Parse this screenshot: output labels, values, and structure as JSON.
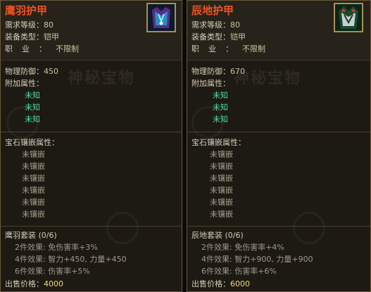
{
  "watermark": "神秘宝物",
  "labels": {
    "level": "需求等级：",
    "type": "装备类型：",
    "job": "职业：",
    "defense": "物理防御：",
    "extra": "附加属性：",
    "gem": "宝石镶嵌属性：",
    "price": "出售价格："
  },
  "items": [
    {
      "name": "鹰羽护甲",
      "level": "80",
      "type": "铠甲",
      "job": "不限制",
      "defense": "450",
      "extra_attrs": [
        "未知",
        "未知",
        "未知"
      ],
      "gem_slots": [
        "未镶嵌",
        "未镶嵌",
        "未镶嵌",
        "未镶嵌",
        "未镶嵌",
        "未镶嵌"
      ],
      "set_name": "鹰羽套装 (0/6)",
      "set_effects": [
        "2件效果: 免伤害率+3%",
        "4件效果: 智力+450, 力量+450",
        "6件效果: 伤害率+5%"
      ],
      "price": "4000"
    },
    {
      "name": "辰地护甲",
      "level": "80",
      "type": "铠甲",
      "job": "不限制",
      "defense": "670",
      "extra_attrs": [
        "未知",
        "未知",
        "未知"
      ],
      "gem_slots": [
        "未镶嵌",
        "未镶嵌",
        "未镶嵌",
        "未镶嵌",
        "未镶嵌",
        "未镶嵌"
      ],
      "set_name": "辰地套装 (0/6)",
      "set_effects": [
        "2件效果: 免伤害率+4%",
        "4件效果: 智力+900, 力量+900",
        "6件效果: 伤害率+6%"
      ],
      "price": "6000"
    }
  ]
}
